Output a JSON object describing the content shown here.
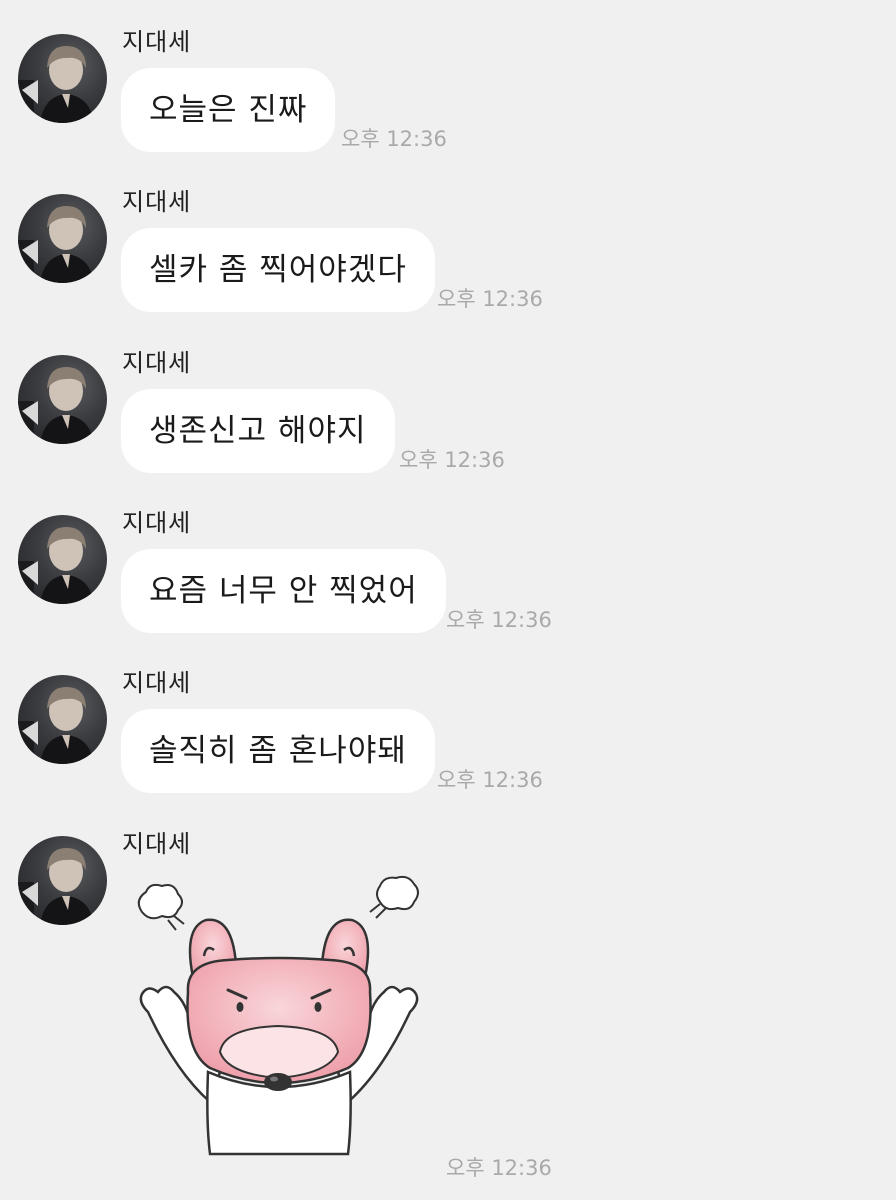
{
  "messages": [
    {
      "sender": "지대세",
      "text": "오늘은 진짜",
      "time": "오후 12:36"
    },
    {
      "sender": "지대세",
      "text": "셀카 좀 찍어야겠다",
      "time": "오후 12:36"
    },
    {
      "sender": "지대세",
      "text": "생존신고 해야지",
      "time": "오후 12:36"
    },
    {
      "sender": "지대세",
      "text": "요즘 너무 안 찍었어",
      "time": "오후 12:36"
    },
    {
      "sender": "지대세",
      "text": "솔직히 좀 혼나야돼",
      "time": "오후 12:36"
    },
    {
      "sender": "지대세",
      "sticker": "angry-pink-bear-sticker",
      "time": "오후 12:36"
    }
  ],
  "colors": {
    "background": "#f0f0f0",
    "bubble": "#ffffff",
    "timestamp": "#a9a9a9"
  }
}
